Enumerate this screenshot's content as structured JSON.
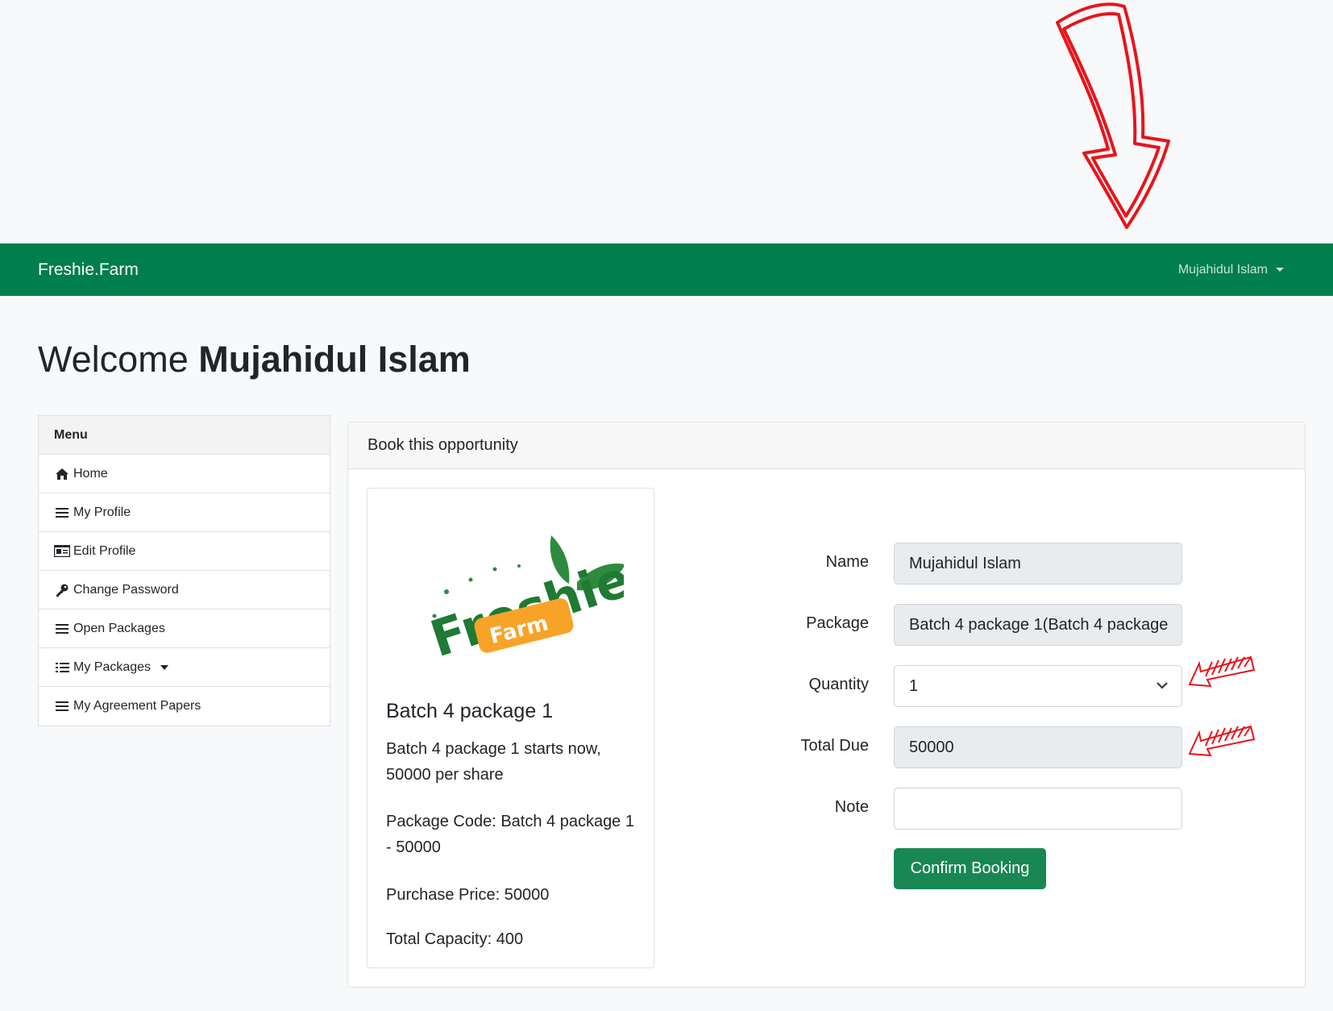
{
  "navbar": {
    "brand": "Freshie.Farm",
    "user_name": "Mujahidul Islam"
  },
  "welcome": {
    "prefix": "Welcome",
    "name": "Mujahidul Islam"
  },
  "menu": {
    "header": "Menu",
    "items": [
      {
        "label": "Home",
        "icon": "home-icon"
      },
      {
        "label": "My Profile",
        "icon": "list-icon"
      },
      {
        "label": "Edit Profile",
        "icon": "id-card-icon"
      },
      {
        "label": "Change Password",
        "icon": "key-icon"
      },
      {
        "label": "Open Packages",
        "icon": "list-icon"
      },
      {
        "label": "My Packages",
        "icon": "list-check-icon"
      },
      {
        "label": "My Agreement Papers",
        "icon": "list-icon"
      }
    ]
  },
  "booking": {
    "header": "Book this opportunity",
    "package_card": {
      "logo_text": "Freshie Farm",
      "title": "Batch 4 package 1",
      "description": "Batch 4 package 1 starts now, 50000 per share",
      "package_code": "Package Code: Batch 4 package 1 - 50000",
      "purchase_price": "Purchase Price: 50000",
      "total_capacity": "Total Capacity: 400"
    },
    "form": {
      "name_label": "Name",
      "name_value": "Mujahidul Islam",
      "package_label": "Package",
      "package_value": "Batch 4 package 1(Batch 4 package",
      "quantity_label": "Quantity",
      "quantity_value": "1",
      "total_due_label": "Total Due",
      "total_due_value": "50000",
      "note_label": "Note",
      "note_value": "",
      "confirm_label": "Confirm Booking"
    }
  },
  "colors": {
    "navbar": "#007e4c",
    "button": "#198754",
    "annotation": "#e30613"
  }
}
